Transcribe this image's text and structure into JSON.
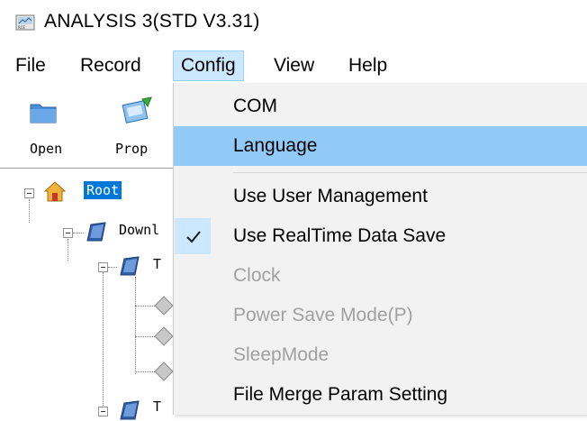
{
  "window": {
    "title": "ANALYSIS 3(STD V3.31)"
  },
  "menubar": {
    "items": [
      {
        "label": "File"
      },
      {
        "label": "Record"
      },
      {
        "label": "Config"
      },
      {
        "label": "View"
      },
      {
        "label": "Help"
      }
    ],
    "active": "Config"
  },
  "toolbar": {
    "buttons": [
      {
        "label": "Open",
        "icon": "folder-icon"
      },
      {
        "label": "Prop",
        "icon": "properties-icon"
      }
    ]
  },
  "tree": {
    "root_label": "Root",
    "download_label": "Downl",
    "child_label_1": "T",
    "child_label_2": "T"
  },
  "config_menu": {
    "items": [
      {
        "label": "COM",
        "enabled": true
      },
      {
        "label": "Language",
        "enabled": true,
        "highlighted": true
      },
      {
        "label": "Use User Management",
        "enabled": true
      },
      {
        "label": "Use RealTime Data Save",
        "enabled": true,
        "checked": true
      },
      {
        "label": "Clock",
        "enabled": false
      },
      {
        "label": "Power Save Mode(P)",
        "enabled": false
      },
      {
        "label": "SleepMode",
        "enabled": false
      },
      {
        "label": "File Merge Param Setting",
        "enabled": true
      }
    ]
  },
  "colors": {
    "menu_active_bg": "#cce8ff",
    "dropdown_bg": "#f2f2f2",
    "dropdown_highlight": "#91c9f7",
    "tree_selected": "#0078d7",
    "disabled_text": "#a0a0a0"
  }
}
